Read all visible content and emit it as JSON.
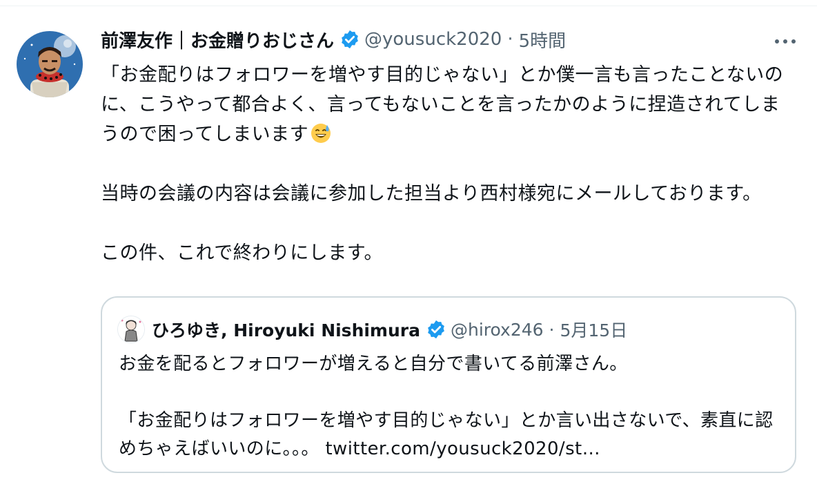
{
  "tweet": {
    "author_name": "前澤友作｜お金贈りおじさん",
    "handle": "@yousuck2020",
    "separator": "·",
    "time": "5時間",
    "more_icon": "more-horizontal-icon",
    "verified_icon": "verified-badge-icon",
    "paragraphs": [
      "「お金配りはフォロワーを増やす目的じゃない」とか僕一言も言ったことないのに、こうやって都合よく、言ってもないことを言ったかのように捏造されてしまうので困ってしまいます",
      "当時の会議の内容は会議に参加した担当より西村様宛にメールしております。",
      "この件、これで終わりにします。"
    ],
    "emoji": "grinning-face-with-sweat-emoji"
  },
  "quote": {
    "author_name": "ひろゆき, Hiroyuki Nishimura",
    "handle": "@hirox246",
    "separator": "·",
    "date": "5月15日",
    "paragraphs": [
      "お金を配るとフォロワーが増えると自分で書いてる前澤さん。",
      "「お金配りはフォロワーを増やす目的じゃない」とか言い出さないで、素直に認めちゃえばいいのに。。。 twitter.com/yousuck2020/st…"
    ]
  },
  "colors": {
    "verified_blue": "#1d9bf0",
    "secondary_text": "#536471",
    "border": "#cfd9de"
  }
}
